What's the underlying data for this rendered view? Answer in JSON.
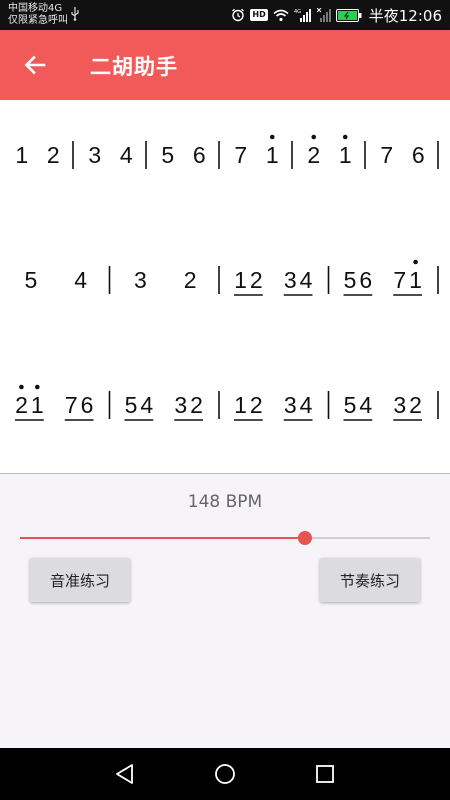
{
  "status_bar": {
    "carrier_line1": "中国移动4G",
    "carrier_line2": "仅限紧急呼叫",
    "hd_badge": "HD",
    "time": "半夜12:06",
    "icons": [
      "usb-icon",
      "alarm-icon",
      "hd-icon",
      "wifi-icon",
      "signal-4g-icon",
      "signal-x-icon",
      "battery-icon"
    ]
  },
  "app_bar": {
    "title": "二胡助手",
    "back_icon": "arrow-left-icon",
    "color": "#f25a5a"
  },
  "notation": {
    "rows": [
      [
        [
          {
            "t": "1"
          },
          {
            "t": "2"
          }
        ],
        [
          {
            "t": "3"
          },
          {
            "t": "4"
          }
        ],
        [
          {
            "t": "5"
          },
          {
            "t": "6"
          }
        ],
        [
          {
            "t": "7"
          },
          {
            "t": "1",
            "dot": 1
          }
        ],
        [
          {
            "t": "2",
            "dot": 1
          },
          {
            "t": "1",
            "dot": 1
          }
        ],
        [
          {
            "t": "7"
          },
          {
            "t": "6"
          }
        ]
      ],
      [
        [
          {
            "t": "5"
          },
          {
            "t": "4"
          }
        ],
        [
          {
            "t": "3"
          },
          {
            "t": "2"
          }
        ],
        [
          {
            "t": "12",
            "ul": 1
          },
          {
            "t": "34",
            "ul": 1
          }
        ],
        [
          {
            "t": "56",
            "ul": 1
          },
          {
            "t": "71",
            "ul": 1,
            "dot": 1
          }
        ]
      ],
      [
        [
          {
            "t": "21",
            "ul": 1,
            "dot": 2
          },
          {
            "t": "76",
            "ul": 1
          }
        ],
        [
          {
            "t": "54",
            "ul": 1
          },
          {
            "t": "32",
            "ul": 1
          }
        ],
        [
          {
            "t": "12",
            "ul": 1
          },
          {
            "t": "34",
            "ul": 1
          }
        ],
        [
          {
            "t": "54",
            "ul": 1
          },
          {
            "t": "32",
            "ul": 1
          }
        ]
      ]
    ]
  },
  "tempo": {
    "label": "148 BPM",
    "slider_value_fraction": 0.694
  },
  "buttons": {
    "pitch_practice": "音准练习",
    "rhythm_practice": "节奏练习"
  },
  "nav_bar": {
    "icons": [
      "nav-back-icon",
      "nav-home-icon",
      "nav-recent-icon"
    ]
  },
  "colors": {
    "accent": "#f25a5a",
    "slider": "#e55353",
    "panel_bg": "#f6f4f8",
    "button_bg": "#dcdbdd"
  }
}
